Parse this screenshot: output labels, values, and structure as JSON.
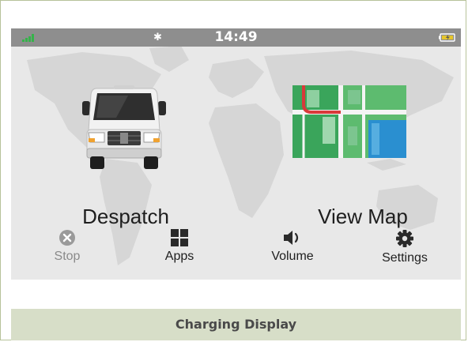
{
  "status_bar": {
    "time": "14:49",
    "bluetooth_glyph": "✱",
    "signal_icon": "signal-bars-icon",
    "battery_icon": "battery-charging-icon"
  },
  "tiles": {
    "despatch_label": "Despatch",
    "despatch_icon": "delivery-van-icon",
    "view_map_label": "View Map",
    "view_map_icon": "map-icon"
  },
  "bottom_buttons": {
    "stop": {
      "label": "Stop",
      "icon": "stop-circle-icon"
    },
    "apps": {
      "label": "Apps",
      "icon": "grid-icon"
    },
    "volume": {
      "label": "Volume",
      "icon": "speaker-icon"
    },
    "settings": {
      "label": "Settings",
      "icon": "gear-icon"
    }
  },
  "caption": "Charging Display",
  "colors": {
    "status_bar": "#8e8e8e",
    "background": "#e6e6e6",
    "caption_bar": "#d7dec8",
    "signal": "#35b34a",
    "map_green": "#3aa55b",
    "map_blue": "#2a8fd0"
  }
}
